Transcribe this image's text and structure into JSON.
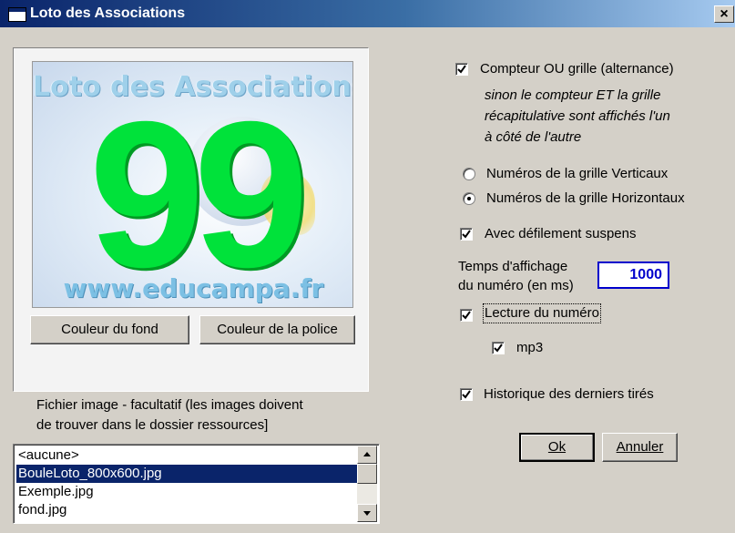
{
  "window": {
    "title": "Loto des Associations",
    "close_label": "×"
  },
  "preview": {
    "header_text": "Loto des Associations",
    "number": "99",
    "footer_text": "www.educampa.fr"
  },
  "buttons": {
    "bg_color": "Couleur du fond",
    "font_color": "Couleur de la police",
    "ok": "Ok",
    "cancel": "Annuler"
  },
  "image_file": {
    "label_line1": "Fichier image - facultatif (les images doivent",
    "label_line2": "de trouver dans le dossier ressources]",
    "items": [
      "<aucune>",
      "BouleLoto_800x600.jpg",
      "Exemple.jpg",
      "fond.jpg"
    ],
    "selected": "BouleLoto_800x600.jpg"
  },
  "options": {
    "compteur_ou_grille": {
      "label": "Compteur OU grille (alternance)",
      "checked": true
    },
    "compteur_note": [
      "sinon le compteur ET la grille",
      "récapitulative sont affichés l'un",
      "à côté de l'autre"
    ],
    "radio_vertical": {
      "label": "Numéros de la grille Verticaux",
      "selected": false
    },
    "radio_horizontal": {
      "label": "Numéros de la grille Horizontaux",
      "selected": true
    },
    "defilement": {
      "label": "Avec défilement suspens",
      "checked": true
    },
    "temps_label_line1": "Temps d'affichage",
    "temps_label_line2": "du numéro (en ms)",
    "temps_value": "1000",
    "lecture": {
      "label": "Lecture du numéro",
      "checked": true
    },
    "mp3": {
      "label": "mp3",
      "checked": true
    },
    "historique": {
      "label": "Historique des derniers tirés",
      "checked": true
    }
  },
  "colors": {
    "title_bar": "#0a246a",
    "face": "#d4d0c8",
    "number_green": "#00e23a",
    "input_blue": "#0000cc"
  }
}
